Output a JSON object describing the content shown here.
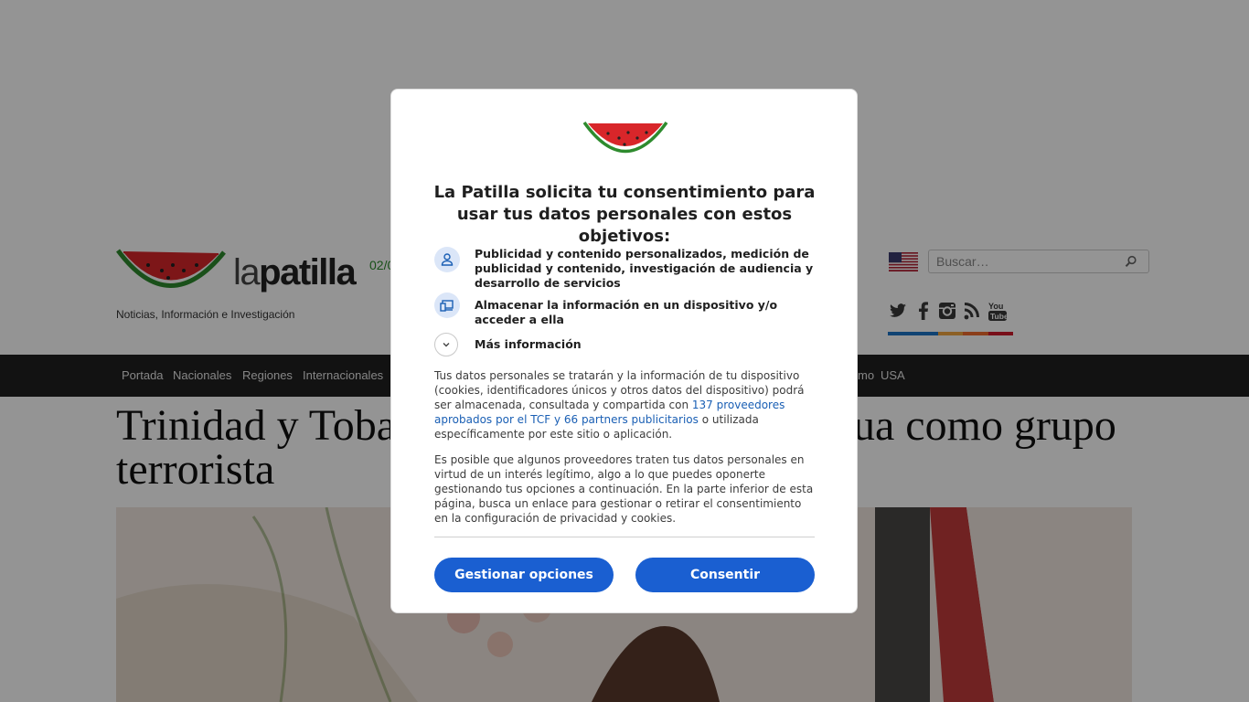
{
  "site": {
    "logo_text_light": "la",
    "logo_text_bold": "patilla",
    "tagline": "Noticias, Información e Investigación",
    "date_fragment": "02/0",
    "search": {
      "placeholder": "Buscar…"
    },
    "social_icons": [
      "twitter-icon",
      "facebook-icon",
      "instagram-icon",
      "rss-icon",
      "youtube-icon"
    ],
    "social_bar_colors": [
      "#1d74c6",
      "#1d74c6",
      "#f2a541",
      "#f06b2e",
      "#cf1b2b"
    ]
  },
  "nav": {
    "items": [
      "Portada",
      "Nacionales",
      "Regiones",
      "Internacionales",
      "mo",
      "USA"
    ]
  },
  "article": {
    "headline_line1_left": "Trinidad y Toba",
    "headline_line1_right": "ua como grupo",
    "headline_line2": "terrorista"
  },
  "consent": {
    "title": "La Patilla solicita tu consentimiento para usar tus datos personales con estos objetivos:",
    "purposes": [
      {
        "icon": "person-icon",
        "text": "Publicidad y contenido personalizados, medición de publicidad y contenido, investigación de audiencia y desarrollo de servicios"
      },
      {
        "icon": "devices-icon",
        "text": "Almacenar la información en un dispositivo y/o acceder a ella"
      }
    ],
    "more_info": "Más información",
    "para1_before": "Tus datos personales se tratarán y la información de tu dispositivo (cookies, identificadores únicos y otros datos del dispositivo) podrá ser almacenada, consultada y compartida con ",
    "para1_link": "137 proveedores aprobados por el TCF y 66 partners publicitarios",
    "para1_after": " o utilizada específicamente por este sitio o aplicación.",
    "para2": "Es posible que algunos proveedores traten tus datos personales en virtud de un interés legítimo, algo a lo que puedes oponerte gestionando tus opciones a continuación. En la parte inferior de esta página, busca un enlace para gestionar o retirar el consentimiento en la configuración de privacidad y cookies.",
    "buttons": {
      "manage": "Gestionar opciones",
      "accept": "Consentir"
    },
    "accent_color": "#1a5fd1"
  }
}
